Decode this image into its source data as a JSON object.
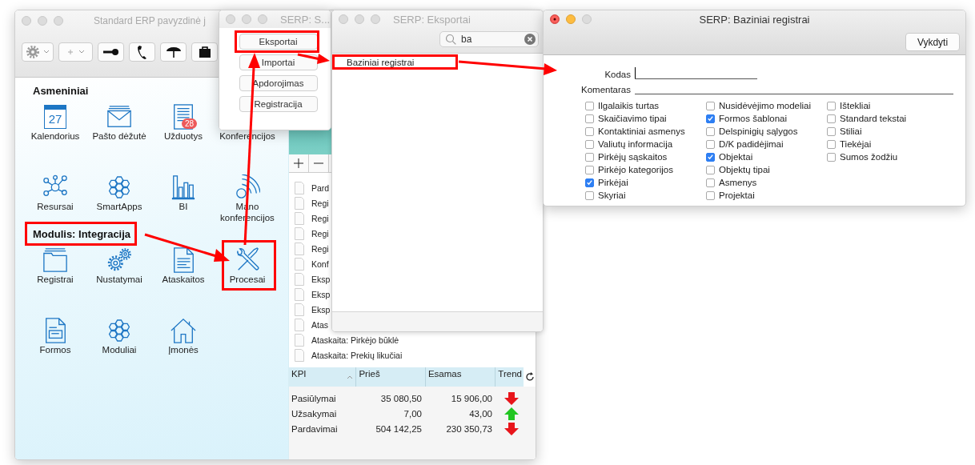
{
  "main_window": {
    "title": "Standard ERP pavyzdinė j",
    "sections": [
      {
        "heading": "Asmeniniai",
        "highlighted": false,
        "items": [
          {
            "label": "Kalendorius",
            "kind": "calendar",
            "icon_text": "27",
            "highlighted": false
          },
          {
            "label": "Pašto dėžutė",
            "kind": "mail",
            "highlighted": false
          },
          {
            "label": "Užduotys",
            "kind": "tasks",
            "badge": "28",
            "highlighted": false
          },
          {
            "label": "Konferencijos",
            "kind": "hidden",
            "highlighted": false
          },
          {
            "label": "Resursai",
            "kind": "network",
            "highlighted": false
          },
          {
            "label": "SmartApps",
            "kind": "hexagons",
            "highlighted": false
          },
          {
            "label": "BI",
            "kind": "chart",
            "highlighted": false
          },
          {
            "label": "Mano konferencijos",
            "kind": "signal",
            "highlighted": false
          }
        ]
      },
      {
        "heading": "Modulis: Integracija",
        "highlighted": true,
        "items": [
          {
            "label": "Registrai",
            "kind": "folder",
            "highlighted": false
          },
          {
            "label": "Nustatymai",
            "kind": "gears",
            "highlighted": false
          },
          {
            "label": "Ataskaitos",
            "kind": "report",
            "highlighted": false
          },
          {
            "label": "Procesai",
            "kind": "tools",
            "highlighted": true
          },
          {
            "label": "Formos",
            "kind": "form",
            "highlighted": false
          },
          {
            "label": "Moduliai",
            "kind": "hexagons",
            "highlighted": false
          },
          {
            "label": "Įmonės",
            "kind": "house",
            "highlighted": false
          }
        ]
      }
    ],
    "documents": [
      "Pard",
      "Regi",
      "Regi",
      "Regi",
      "Regi",
      "Konf",
      "Eksp",
      "Eksp",
      "Eksp",
      "Atas",
      "Ataskaita: Pirkėjo būklė",
      "Ataskaita: Prekių likučiai"
    ],
    "kpi_table": {
      "columns": [
        "KPI",
        "Prieš",
        "Esamas",
        "Trend"
      ],
      "rows": [
        {
          "kpi": "Pasiūlymai",
          "before": "35 080,50",
          "current": "15 906,00",
          "rising": false
        },
        {
          "kpi": "Užsakymai",
          "before": "7,00",
          "current": "43,00",
          "rising": true
        },
        {
          "kpi": "Pardavimai",
          "before": "504 142,25",
          "current": "230 350,73",
          "rising": false
        }
      ]
    }
  },
  "processes_window": {
    "title": "SERP: S...",
    "buttons": [
      {
        "label": "Eksportai",
        "highlighted": true
      },
      {
        "label": "Importai",
        "highlighted": false
      },
      {
        "label": "Apdorojimas",
        "highlighted": false
      },
      {
        "label": "Registracija",
        "highlighted": false
      }
    ]
  },
  "exports_window": {
    "title": "SERP: Eksportai",
    "search": {
      "value": "ba"
    },
    "items": [
      {
        "label": "Baziniai registrai",
        "highlighted": true
      }
    ]
  },
  "registers_window": {
    "title": "SERP: Baziniai registrai",
    "button": "Vykdyti",
    "fields": [
      {
        "label": "Kodas",
        "focused": true
      },
      {
        "label": "Komentaras",
        "focused": false
      }
    ],
    "checkbox_columns": [
      [
        {
          "label": "Ilgalaikis turtas",
          "checked": false
        },
        {
          "label": "Skaičiavimo tipai",
          "checked": false
        },
        {
          "label": "Kontaktiniai asmenys",
          "checked": false
        },
        {
          "label": "Valiutų informacija",
          "checked": false
        },
        {
          "label": "Pirkėjų sąskaitos",
          "checked": false
        },
        {
          "label": "Pirkėjo kategorijos",
          "checked": false
        },
        {
          "label": "Pirkėjai",
          "checked": true
        },
        {
          "label": "Skyriai",
          "checked": false
        }
      ],
      [
        {
          "label": "Nusidėvėjimo modeliai",
          "checked": false
        },
        {
          "label": "Formos šablonai",
          "checked": true
        },
        {
          "label": "Delspinigių sąlygos",
          "checked": false
        },
        {
          "label": "D/K padidėjimai",
          "checked": false
        },
        {
          "label": "Objektai",
          "checked": true
        },
        {
          "label": "Objektų tipai",
          "checked": false
        },
        {
          "label": "Asmenys",
          "checked": false
        },
        {
          "label": "Projektai",
          "checked": false
        }
      ],
      [
        {
          "label": "Ištekliai",
          "checked": false
        },
        {
          "label": "Standard tekstai",
          "checked": false
        },
        {
          "label": "Stiliai",
          "checked": false
        },
        {
          "label": "Tiekėjai",
          "checked": false
        },
        {
          "label": "Sumos žodžiu",
          "checked": false
        }
      ]
    ]
  }
}
